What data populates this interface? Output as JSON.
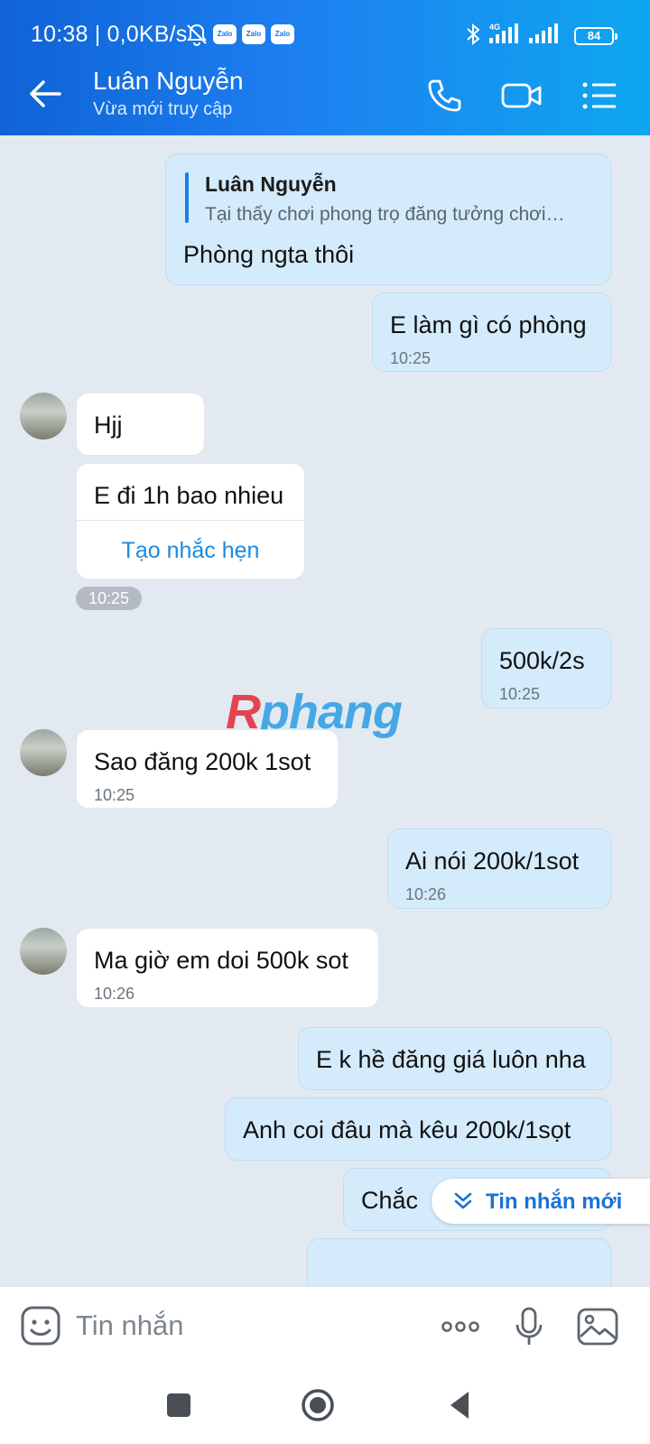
{
  "status_bar": {
    "text": "10:38 | 0,0KB/s",
    "app_badges": [
      "Zalo",
      "Zalo",
      "Zalo"
    ],
    "network": "4G",
    "battery": "84"
  },
  "header": {
    "contact_name": "Luân Nguyễn",
    "contact_status": "Vừa mới truy cập"
  },
  "messages": [
    {
      "sender": "me",
      "quote_name": "Luân Nguyễn",
      "quote_text": "Tại thấy chơi phong trọ đăng tưởng chơi…",
      "text": "Phòng ngta thôi"
    },
    {
      "sender": "me",
      "text": "E làm gì có phòng",
      "time": "10:25"
    },
    {
      "sender": "them",
      "text": "Hjj"
    },
    {
      "sender": "them",
      "text": "E đi 1h bao nhieu",
      "action": "Tạo nhắc hẹn"
    },
    {
      "sender": "them",
      "time_pill": "10:25"
    },
    {
      "sender": "me",
      "text": "500k/2s",
      "time": "10:25"
    },
    {
      "sender": "them",
      "text": "Sao đăng 200k 1sot",
      "time": "10:25"
    },
    {
      "sender": "me",
      "text": "Ai nói 200k/1sot",
      "time": "10:26"
    },
    {
      "sender": "them",
      "text": "Ma giờ em doi 500k sot",
      "time": "10:26"
    },
    {
      "sender": "me",
      "text": "E k hề đăng giá luôn nha"
    },
    {
      "sender": "me",
      "text": "Anh coi đâu mà kêu 200k/1sọt"
    },
    {
      "sender": "me",
      "text": "Chắc"
    }
  ],
  "watermark": {
    "part1": "R",
    "part2": "phang"
  },
  "new_messages_label": "Tin nhắn mới",
  "composer": {
    "placeholder": "Tin nhắn"
  },
  "colors": {
    "header_start": "#0f63d6",
    "header_end": "#0ea7ef",
    "my_bubble": "#d4ebfb",
    "their_bubble": "#ffffff",
    "link": "#1a8ae2"
  }
}
